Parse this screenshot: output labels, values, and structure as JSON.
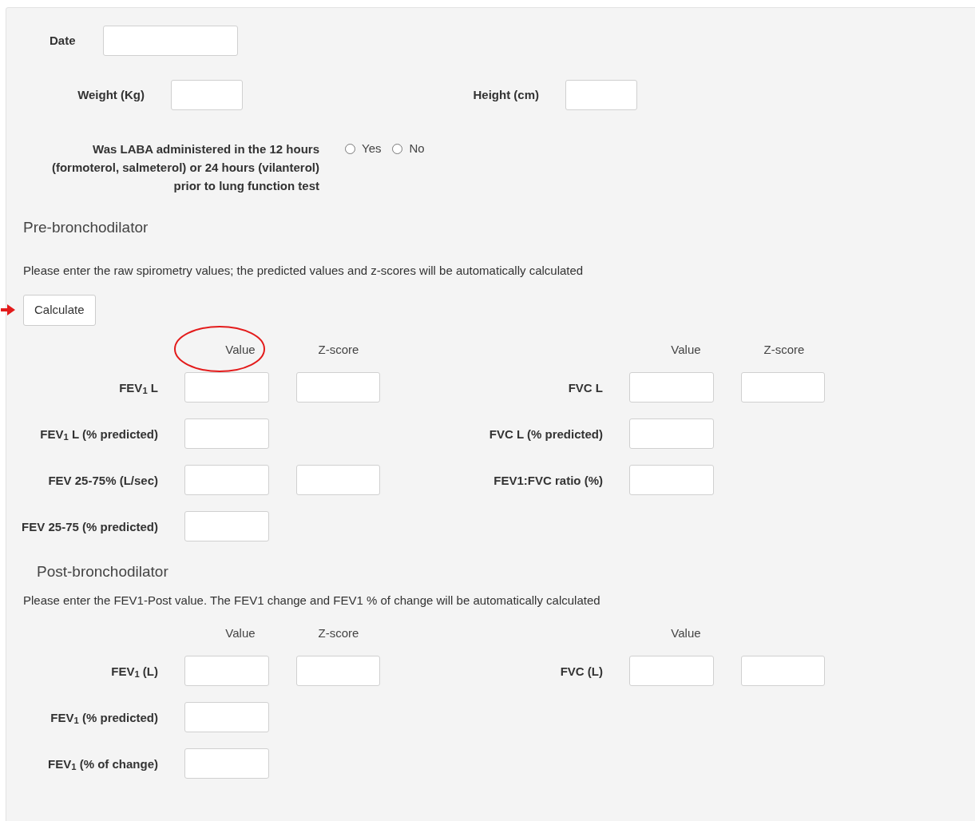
{
  "date": {
    "label": "Date"
  },
  "measures": [
    {
      "label": "Weight (Kg)"
    },
    {
      "label": "Height (cm)"
    }
  ],
  "laba": {
    "question": "Was LABA administered in the 12 hours (formoterol, salmeterol) or 24 hours (vilanterol) prior to lung function test",
    "options": [
      {
        "label": "Yes",
        "selected": false
      },
      {
        "label": "No",
        "selected": false
      }
    ]
  },
  "pre": {
    "title": "Pre-bronchodilator",
    "instruction": "Please enter the raw spirometry values; the predicted values and z-scores will be automatically calculated",
    "button": "Calculate",
    "headers_left": [
      "Value",
      "Z-score"
    ],
    "headers_right": [
      "Value",
      "Z-score"
    ],
    "rows": [
      {
        "left": {
          "label": "FEV$_{1}$ L",
          "kind": "value_zscore"
        },
        "right": {
          "label": "FVC L",
          "kind": "value_zscore"
        }
      },
      {
        "left": {
          "label": "FEV$_{1}$ L (% predicted)",
          "kind": "value"
        },
        "right": {
          "label": "FVC L (% predicted)",
          "kind": "value"
        }
      },
      {
        "left": {
          "label": "FEV 25-75% (L/sec)",
          "kind": "value_zscore"
        },
        "right": {
          "label": "FEV1:FVC ratio (%)",
          "kind": "value"
        }
      },
      {
        "left": {
          "label": "FEV 25-75 (% predicted)",
          "kind": "value"
        }
      }
    ]
  },
  "post": {
    "title": "Post-bronchodilator",
    "instruction": "Please enter the FEV1-Post value. The FEV1 change and FEV1 % of change will be automatically calculated",
    "headers_left": [
      "Value",
      "Z-score"
    ],
    "headers_right": [
      "Value"
    ],
    "rows": [
      {
        "left": {
          "label": "FEV$_{1}$ (L)",
          "kind": "value_zscore"
        },
        "right": {
          "label": "FVC (L)",
          "kind": "value_zscore"
        }
      },
      {
        "left": {
          "label": "FEV$_{1}$ (% predicted)",
          "kind": "value"
        }
      },
      {
        "left": {
          "label": "FEV$_{1}$ (% of change)",
          "kind": "value"
        }
      }
    ]
  }
}
